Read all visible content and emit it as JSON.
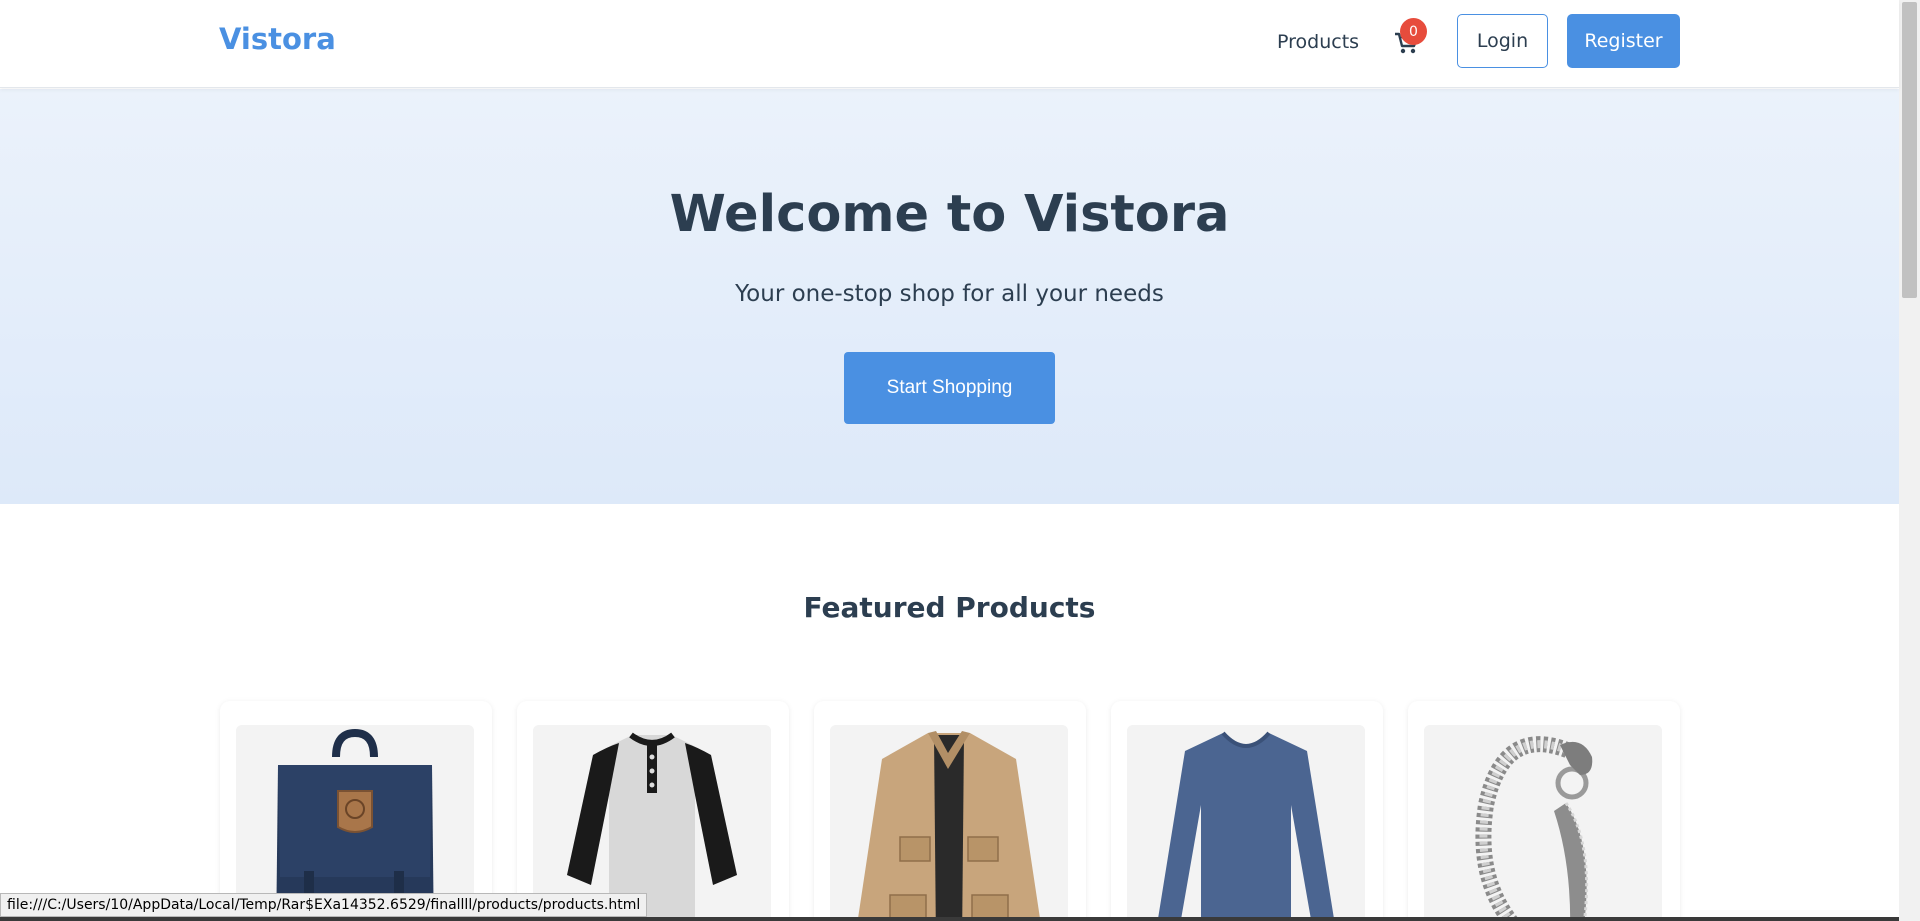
{
  "header": {
    "logo": "Vistora",
    "nav_products": "Products",
    "cart_count": "0",
    "login_label": "Login",
    "register_label": "Register"
  },
  "hero": {
    "title": "Welcome to Vistora",
    "subtitle": "Your one-stop shop for all your needs",
    "cta_label": "Start Shopping"
  },
  "featured": {
    "title": "Featured Products",
    "products": [
      {
        "image": "navy-backpack"
      },
      {
        "image": "raglan-henley-shirt"
      },
      {
        "image": "khaki-jacket"
      },
      {
        "image": "blue-v-neck-sweater"
      },
      {
        "image": "silver-dragon-bracelet"
      }
    ]
  },
  "status_bar": {
    "url": "file:///C:/Users/10/AppData/Local/Temp/Rar$EXa14352.6529/finallll/products/products.html"
  },
  "colors": {
    "brand": "#4a90e2",
    "text": "#2c3e50",
    "badge": "#e74c3c"
  }
}
